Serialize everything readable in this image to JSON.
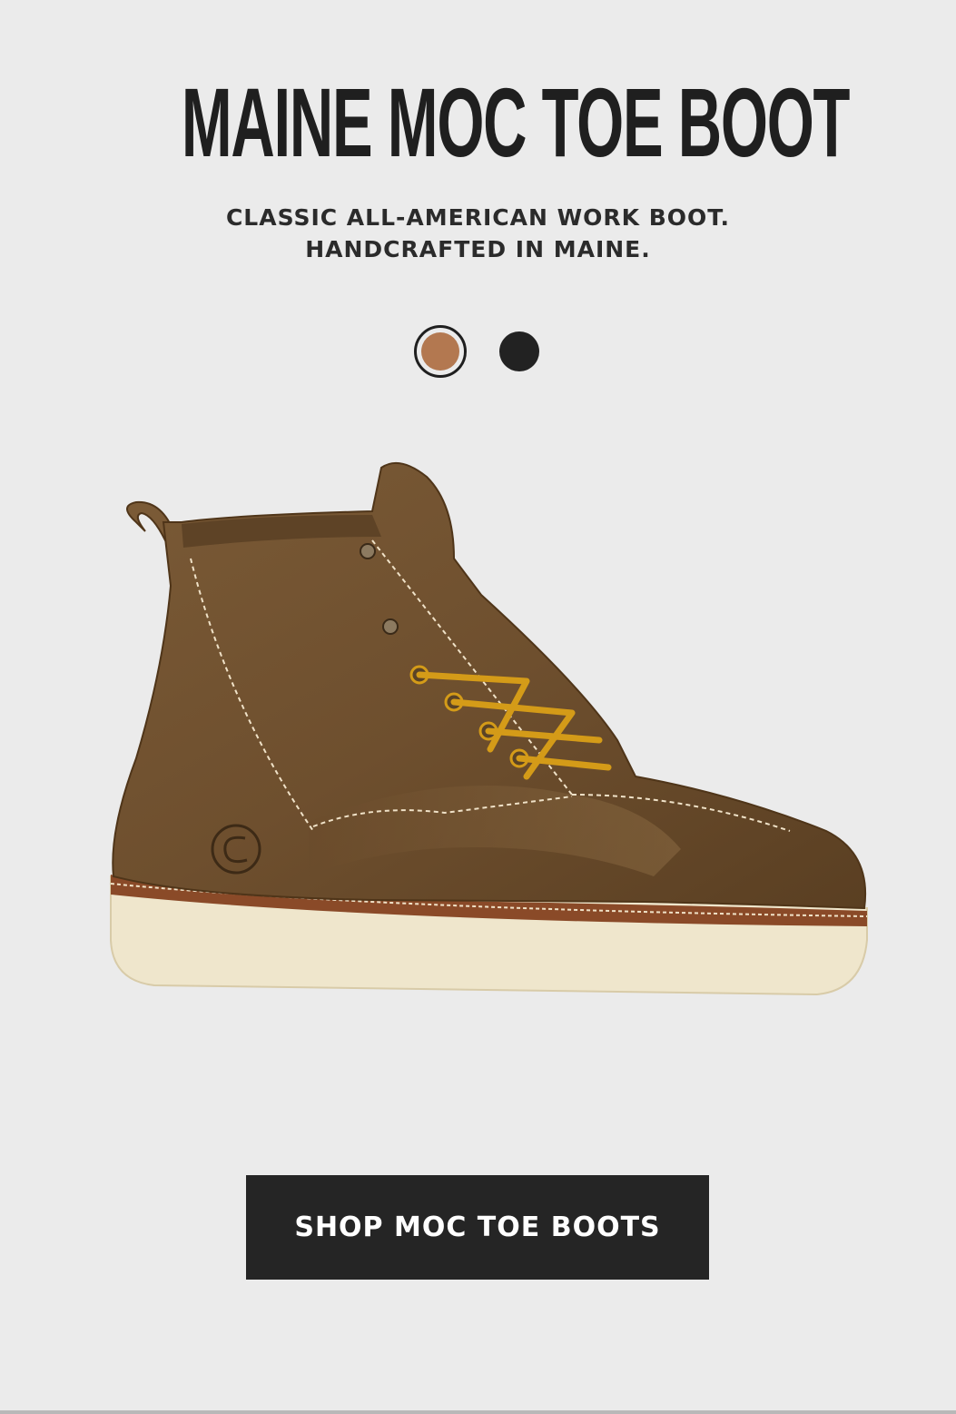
{
  "headline": "MAINE MOC TOE BOOT",
  "subhead": {
    "line1": "CLASSIC ALL-AMERICAN WORK BOOT.",
    "line2": "HANDCRAFTED IN MAINE."
  },
  "swatches": [
    {
      "name": "brown",
      "color": "#b37850",
      "selected": true
    },
    {
      "name": "black",
      "color": "#222222",
      "selected": false
    }
  ],
  "product_image": {
    "icon": "moc-toe-boot-image",
    "leather_color": "#6e4f2e",
    "sole_color": "#efe6cc",
    "lace_color": "#d49b18"
  },
  "cta": {
    "label": "SHOP MOC TOE BOOTS",
    "background": "#252525"
  }
}
